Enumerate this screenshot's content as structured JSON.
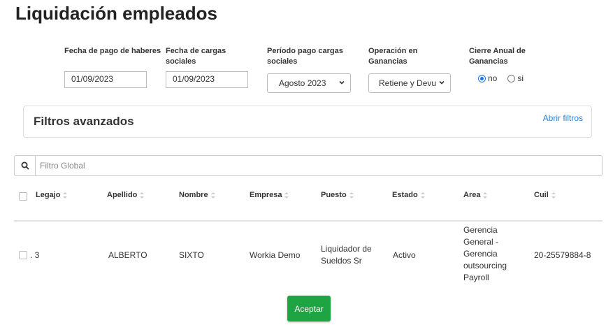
{
  "page": {
    "title": "Liquidación empleados"
  },
  "filters": {
    "fecha_pago": {
      "label": "Fecha de pago de haberes",
      "value": "01/09/2023"
    },
    "fecha_cargas": {
      "label": "Fecha de cargas sociales",
      "value": "01/09/2023"
    },
    "periodo_cargas": {
      "label": "Período pago cargas sociales",
      "selected": "Agosto 2023"
    },
    "operacion_ganancias": {
      "label": "Operación en Ganancias",
      "selected": "Retiene y Devu"
    },
    "cierre_anual": {
      "label": "Cierre Anual de Ganancias",
      "option_no": "no",
      "option_si": "si",
      "selected": "no"
    }
  },
  "advanced": {
    "title": "Filtros avanzados",
    "link": "Abrir filtros"
  },
  "search": {
    "placeholder": "Filtro Global"
  },
  "table": {
    "columns": [
      "Legajo",
      "Apellido",
      "Nombre",
      "Empresa",
      "Puesto",
      "Estado",
      "Area",
      "Cuil"
    ],
    "rows": [
      {
        "legajo": ". 3",
        "apellido": "ALBERTO",
        "nombre": "SIXTO",
        "empresa": "Workia Demo",
        "puesto_1": "Liquidador de",
        "puesto_2": "Sueldos Sr",
        "estado": "Activo",
        "area_1": "Gerencia",
        "area_2": "General -",
        "area_3": "Gerencia",
        "area_4": "outsourcing",
        "area_5": "Payroll",
        "cuil": "20-25579884-8"
      }
    ]
  },
  "actions": {
    "accept": "Aceptar"
  },
  "colors": {
    "accent": "#1a73e8",
    "button_green": "#1fa444",
    "link": "#2d7fd1"
  }
}
